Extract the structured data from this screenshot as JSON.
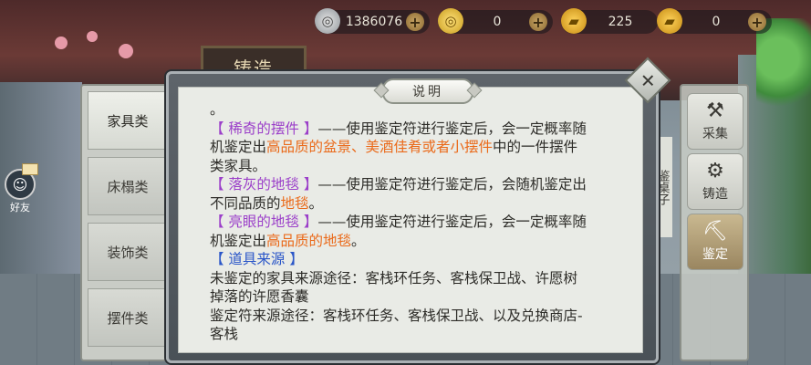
{
  "resources": [
    {
      "icon": "silver-coin-icon",
      "value": "1386076"
    },
    {
      "icon": "gold-coin-icon",
      "value": "0"
    },
    {
      "icon": "gold-ingot-icon",
      "value": "225"
    },
    {
      "icon": "ingot-icon",
      "value": "0"
    }
  ],
  "sign_text": "铸造",
  "left_tabs": [
    "家具类",
    "床榻类",
    "装饰类",
    "摆件类"
  ],
  "friend_label": "好友",
  "right_buttons": [
    "采集",
    "铸造",
    "鉴定"
  ],
  "side_strip_text": "鉴桌子",
  "dialog": {
    "title": "说明",
    "lines": [
      {
        "segments": [
          {
            "t": "。",
            "c": ""
          }
        ]
      },
      {
        "segments": [
          {
            "t": "【 稀奇的摆件 】",
            "c": "purple"
          },
          {
            "t": "——使用鉴定符进行鉴定后，会一定概率随",
            "c": ""
          }
        ]
      },
      {
        "segments": [
          {
            "t": "机鉴定出",
            "c": ""
          },
          {
            "t": "高品质的盆景、美酒佳肴或者小摆件",
            "c": "orange"
          },
          {
            "t": "中的一件摆件",
            "c": ""
          }
        ]
      },
      {
        "segments": [
          {
            "t": "类家具。",
            "c": ""
          }
        ]
      },
      {
        "segments": [
          {
            "t": "【 落灰的地毯 】",
            "c": "purple"
          },
          {
            "t": "——使用鉴定符进行鉴定后，会随机鉴定出",
            "c": ""
          }
        ]
      },
      {
        "segments": [
          {
            "t": "不同品质的",
            "c": ""
          },
          {
            "t": "地毯",
            "c": "orange"
          },
          {
            "t": "。",
            "c": ""
          }
        ]
      },
      {
        "segments": [
          {
            "t": "【 亮眼的地毯 】",
            "c": "purple"
          },
          {
            "t": "——使用鉴定符进行鉴定后，会一定概率随",
            "c": ""
          }
        ]
      },
      {
        "segments": [
          {
            "t": "机鉴定出",
            "c": ""
          },
          {
            "t": "高品质的地毯",
            "c": "orange"
          },
          {
            "t": "。",
            "c": ""
          }
        ]
      },
      {
        "segments": [
          {
            "t": " ",
            "c": ""
          }
        ]
      },
      {
        "segments": [
          {
            "t": "【 道具来源 】",
            "c": "blue"
          }
        ]
      },
      {
        "segments": [
          {
            "t": "未鉴定的家具来源途径：客栈环任务、客栈保卫战、许愿树",
            "c": ""
          }
        ]
      },
      {
        "segments": [
          {
            "t": "掉落的许愿香囊",
            "c": ""
          }
        ]
      },
      {
        "segments": [
          {
            "t": "鉴定符来源途径：客栈环任务、客栈保卫战、以及兑换商店-",
            "c": ""
          }
        ]
      },
      {
        "segments": [
          {
            "t": "客栈",
            "c": ""
          }
        ]
      }
    ]
  },
  "colors": {
    "purple": "#9b3fc9",
    "orange": "#ea6a1a",
    "blue": "#2a56c8"
  }
}
